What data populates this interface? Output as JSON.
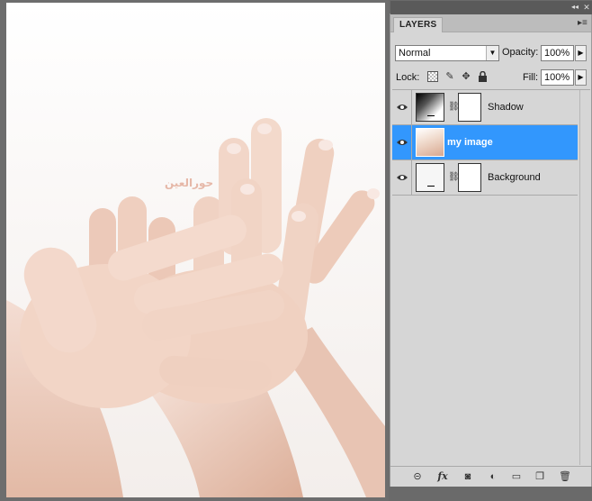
{
  "canvas": {
    "watermark_text": "حورالعين"
  },
  "panel": {
    "tab_label": "LAYERS",
    "blend_mode": "Normal",
    "opacity_label": "Opacity:",
    "opacity_value": "100%",
    "lock_label": "Lock:",
    "fill_label": "Fill:",
    "fill_value": "100%",
    "layers": [
      {
        "name": "Shadow",
        "visible": true,
        "selected": false,
        "has_mask": true
      },
      {
        "name": "my image",
        "visible": true,
        "selected": true,
        "has_mask": false
      },
      {
        "name": "Background",
        "visible": true,
        "selected": false,
        "has_mask": true
      }
    ],
    "selection_color": "#3297fd",
    "panel_color": "#d6d6d6"
  },
  "icons": {
    "collapse": "double-chevron-icon",
    "close": "close-icon",
    "panel_menu": "panel-menu-icon",
    "eye": "eye-icon",
    "chain": "chain-icon",
    "link_layers": "link-icon",
    "fx": "fx-icon",
    "mask": "mask-icon",
    "adjustment": "adjustment-icon",
    "group": "folder-icon",
    "new_layer": "new-layer-icon",
    "delete": "trash-icon"
  }
}
